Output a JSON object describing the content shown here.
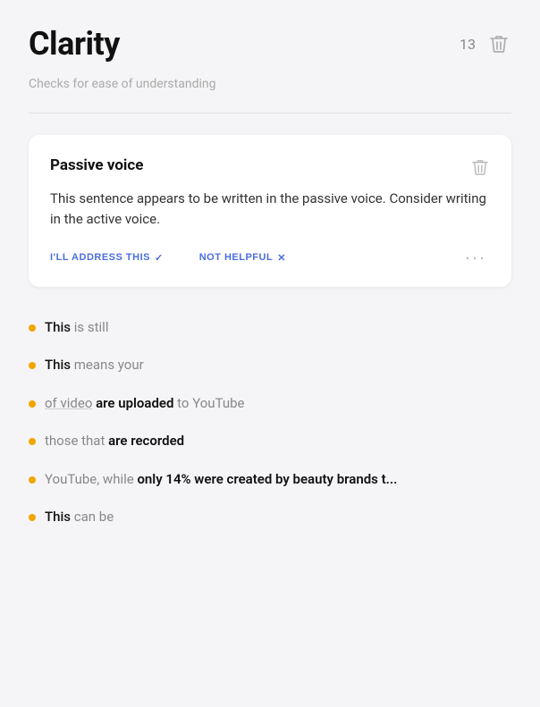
{
  "header": {
    "title": "Clarity",
    "badge_count": "13",
    "trash_label": "delete-all"
  },
  "subtitle": "Checks for ease of understanding",
  "card": {
    "title": "Passive voice",
    "body": "This sentence appears to be written in the passive voice. Consider writing in the active voice.",
    "action_address": "I'LL ADDRESS THIS",
    "action_address_icon": "✓",
    "action_not_helpful": "NOT HELPFUL",
    "action_not_helpful_icon": "✕",
    "more_options_label": "···"
  },
  "issues": [
    {
      "id": 1,
      "prefix": "This",
      "prefix_style": "highlight",
      "suffix": " is still",
      "suffix_style": "plain"
    },
    {
      "id": 2,
      "prefix": "This",
      "prefix_style": "highlight",
      "suffix": " means your",
      "suffix_style": "plain"
    },
    {
      "id": 3,
      "prefix": "of video",
      "prefix_style": "muted-underline",
      "middle": " are uploaded ",
      "middle_style": "bold",
      "suffix": "to YouTube",
      "suffix_style": "plain"
    },
    {
      "id": 4,
      "prefix": "those that",
      "prefix_style": "muted",
      "suffix": " are recorded",
      "suffix_style": "bold"
    },
    {
      "id": 5,
      "prefix": "YouTube, while",
      "prefix_style": "muted",
      "suffix": " only 14% were created by beauty brands t...",
      "suffix_style": "bold"
    },
    {
      "id": 6,
      "prefix": "This",
      "prefix_style": "highlight",
      "suffix": " can be",
      "suffix_style": "plain"
    }
  ]
}
